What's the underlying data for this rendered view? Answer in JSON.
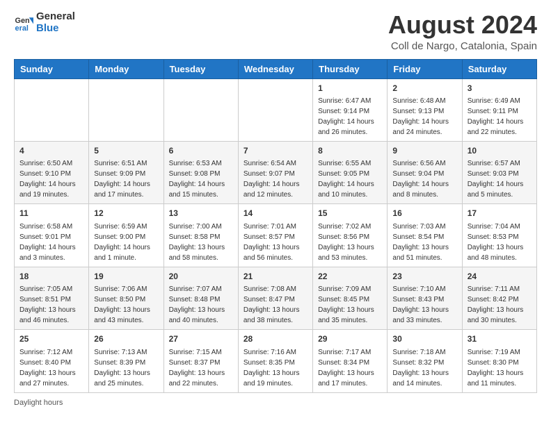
{
  "logo": {
    "line1": "General",
    "line2": "Blue"
  },
  "title": "August 2024",
  "subtitle": "Coll de Nargo, Catalonia, Spain",
  "days_of_week": [
    "Sunday",
    "Monday",
    "Tuesday",
    "Wednesday",
    "Thursday",
    "Friday",
    "Saturday"
  ],
  "footer": "Daylight hours",
  "weeks": [
    [
      {
        "day": "",
        "info": ""
      },
      {
        "day": "",
        "info": ""
      },
      {
        "day": "",
        "info": ""
      },
      {
        "day": "",
        "info": ""
      },
      {
        "day": "1",
        "info": "Sunrise: 6:47 AM\nSunset: 9:14 PM\nDaylight: 14 hours\nand 26 minutes."
      },
      {
        "day": "2",
        "info": "Sunrise: 6:48 AM\nSunset: 9:13 PM\nDaylight: 14 hours\nand 24 minutes."
      },
      {
        "day": "3",
        "info": "Sunrise: 6:49 AM\nSunset: 9:11 PM\nDaylight: 14 hours\nand 22 minutes."
      }
    ],
    [
      {
        "day": "4",
        "info": "Sunrise: 6:50 AM\nSunset: 9:10 PM\nDaylight: 14 hours\nand 19 minutes."
      },
      {
        "day": "5",
        "info": "Sunrise: 6:51 AM\nSunset: 9:09 PM\nDaylight: 14 hours\nand 17 minutes."
      },
      {
        "day": "6",
        "info": "Sunrise: 6:53 AM\nSunset: 9:08 PM\nDaylight: 14 hours\nand 15 minutes."
      },
      {
        "day": "7",
        "info": "Sunrise: 6:54 AM\nSunset: 9:07 PM\nDaylight: 14 hours\nand 12 minutes."
      },
      {
        "day": "8",
        "info": "Sunrise: 6:55 AM\nSunset: 9:05 PM\nDaylight: 14 hours\nand 10 minutes."
      },
      {
        "day": "9",
        "info": "Sunrise: 6:56 AM\nSunset: 9:04 PM\nDaylight: 14 hours\nand 8 minutes."
      },
      {
        "day": "10",
        "info": "Sunrise: 6:57 AM\nSunset: 9:03 PM\nDaylight: 14 hours\nand 5 minutes."
      }
    ],
    [
      {
        "day": "11",
        "info": "Sunrise: 6:58 AM\nSunset: 9:01 PM\nDaylight: 14 hours\nand 3 minutes."
      },
      {
        "day": "12",
        "info": "Sunrise: 6:59 AM\nSunset: 9:00 PM\nDaylight: 14 hours\nand 1 minute."
      },
      {
        "day": "13",
        "info": "Sunrise: 7:00 AM\nSunset: 8:58 PM\nDaylight: 13 hours\nand 58 minutes."
      },
      {
        "day": "14",
        "info": "Sunrise: 7:01 AM\nSunset: 8:57 PM\nDaylight: 13 hours\nand 56 minutes."
      },
      {
        "day": "15",
        "info": "Sunrise: 7:02 AM\nSunset: 8:56 PM\nDaylight: 13 hours\nand 53 minutes."
      },
      {
        "day": "16",
        "info": "Sunrise: 7:03 AM\nSunset: 8:54 PM\nDaylight: 13 hours\nand 51 minutes."
      },
      {
        "day": "17",
        "info": "Sunrise: 7:04 AM\nSunset: 8:53 PM\nDaylight: 13 hours\nand 48 minutes."
      }
    ],
    [
      {
        "day": "18",
        "info": "Sunrise: 7:05 AM\nSunset: 8:51 PM\nDaylight: 13 hours\nand 46 minutes."
      },
      {
        "day": "19",
        "info": "Sunrise: 7:06 AM\nSunset: 8:50 PM\nDaylight: 13 hours\nand 43 minutes."
      },
      {
        "day": "20",
        "info": "Sunrise: 7:07 AM\nSunset: 8:48 PM\nDaylight: 13 hours\nand 40 minutes."
      },
      {
        "day": "21",
        "info": "Sunrise: 7:08 AM\nSunset: 8:47 PM\nDaylight: 13 hours\nand 38 minutes."
      },
      {
        "day": "22",
        "info": "Sunrise: 7:09 AM\nSunset: 8:45 PM\nDaylight: 13 hours\nand 35 minutes."
      },
      {
        "day": "23",
        "info": "Sunrise: 7:10 AM\nSunset: 8:43 PM\nDaylight: 13 hours\nand 33 minutes."
      },
      {
        "day": "24",
        "info": "Sunrise: 7:11 AM\nSunset: 8:42 PM\nDaylight: 13 hours\nand 30 minutes."
      }
    ],
    [
      {
        "day": "25",
        "info": "Sunrise: 7:12 AM\nSunset: 8:40 PM\nDaylight: 13 hours\nand 27 minutes."
      },
      {
        "day": "26",
        "info": "Sunrise: 7:13 AM\nSunset: 8:39 PM\nDaylight: 13 hours\nand 25 minutes."
      },
      {
        "day": "27",
        "info": "Sunrise: 7:15 AM\nSunset: 8:37 PM\nDaylight: 13 hours\nand 22 minutes."
      },
      {
        "day": "28",
        "info": "Sunrise: 7:16 AM\nSunset: 8:35 PM\nDaylight: 13 hours\nand 19 minutes."
      },
      {
        "day": "29",
        "info": "Sunrise: 7:17 AM\nSunset: 8:34 PM\nDaylight: 13 hours\nand 17 minutes."
      },
      {
        "day": "30",
        "info": "Sunrise: 7:18 AM\nSunset: 8:32 PM\nDaylight: 13 hours\nand 14 minutes."
      },
      {
        "day": "31",
        "info": "Sunrise: 7:19 AM\nSunset: 8:30 PM\nDaylight: 13 hours\nand 11 minutes."
      }
    ]
  ]
}
